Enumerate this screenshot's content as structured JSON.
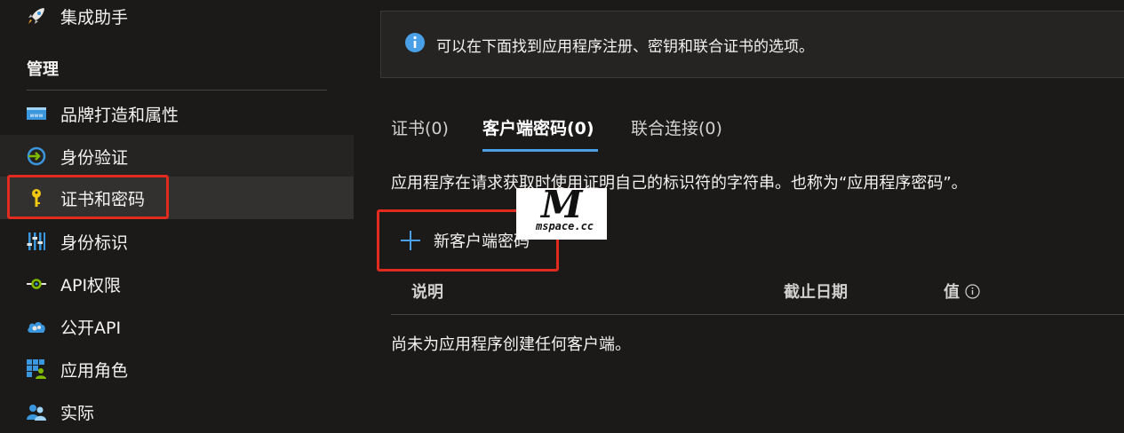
{
  "sidebar": {
    "top_item": {
      "label": "集成助手",
      "icon": "rocket-icon"
    },
    "section_title": "管理",
    "items": [
      {
        "label": "品牌打造和属性",
        "icon": "branding-icon"
      },
      {
        "label": "身份验证",
        "icon": "authentication-icon"
      },
      {
        "label": "证书和密码",
        "icon": "key-icon"
      },
      {
        "label": "身份标识",
        "icon": "token-config-icon"
      },
      {
        "label": "API权限",
        "icon": "api-permissions-icon"
      },
      {
        "label": "公开API",
        "icon": "expose-api-icon"
      },
      {
        "label": "应用角色",
        "icon": "app-roles-icon"
      },
      {
        "label": "实际",
        "icon": "owners-icon"
      }
    ]
  },
  "info_bar": {
    "text": "可以在下面找到应用程序注册、密钥和联合证书的选项。"
  },
  "tabs": [
    {
      "label": "证书(0)"
    },
    {
      "label": "客户端密码(0)"
    },
    {
      "label": "联合连接(0)"
    }
  ],
  "description": "应用程序在请求获取时使用证明自己的标识符的字符串。也称为“应用程序密码”。",
  "new_secret_button": {
    "label": "新客户端密码"
  },
  "table": {
    "columns": [
      "说明",
      "截止日期",
      "值"
    ],
    "empty_message": "尚未为应用程序创建任何客户端。"
  },
  "watermark": {
    "big": "M",
    "small": "mspace.cc"
  },
  "colors": {
    "highlight": "#e22b1f",
    "accent": "#4aa0e6",
    "background": "#1b1a19"
  }
}
